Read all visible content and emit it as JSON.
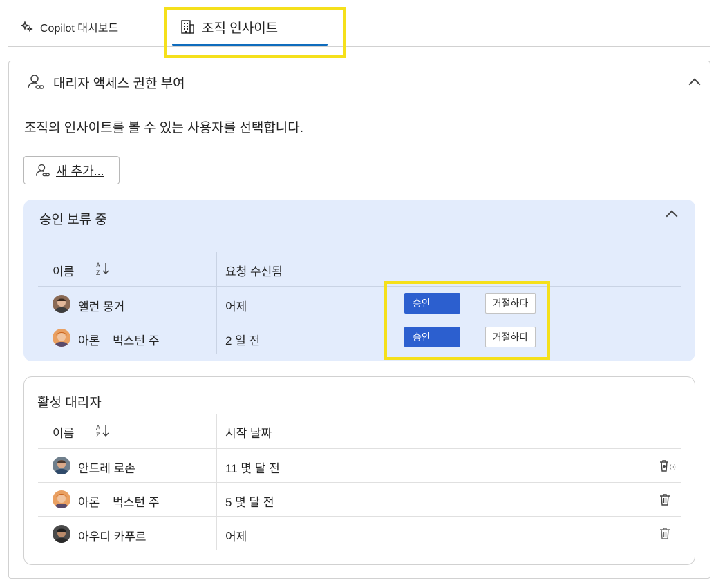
{
  "tabs": [
    {
      "label": "Copilot 대시보드",
      "icon": "sparkle-icon"
    },
    {
      "label": "조직 인사이트",
      "icon": "building-icon"
    }
  ],
  "section": {
    "title": "대리자 액세스 권한 부여",
    "description": "조직의 인사이트를 볼 수 있는 사용자를 선택합니다.",
    "add_button": "새 추가..."
  },
  "pending": {
    "title": "승인 보류 중",
    "col_name": "이름",
    "col_received": "요청 수신됨",
    "approve_label": "승인",
    "reject_label": "거절하다",
    "rows": [
      {
        "name": "앨런 몽거",
        "received": "어제"
      },
      {
        "name": "아론    벅스턴 주",
        "received": "2 일 전"
      }
    ]
  },
  "active": {
    "title": "활성 대리자",
    "col_name": "이름",
    "col_start": "시작 날짜",
    "rows": [
      {
        "name": "안드레 로손",
        "start": "11 몇 달 전"
      },
      {
        "name": "아론    벅스턴 주",
        "start": "5 몇 달 전"
      },
      {
        "name": "아우디 카푸르",
        "start": "어제"
      }
    ]
  },
  "colors": {
    "accent": "#0f6cbd",
    "approve": "#2c5fcf",
    "pending_bg": "#e3ecfc",
    "highlight": "#f5e01b"
  }
}
